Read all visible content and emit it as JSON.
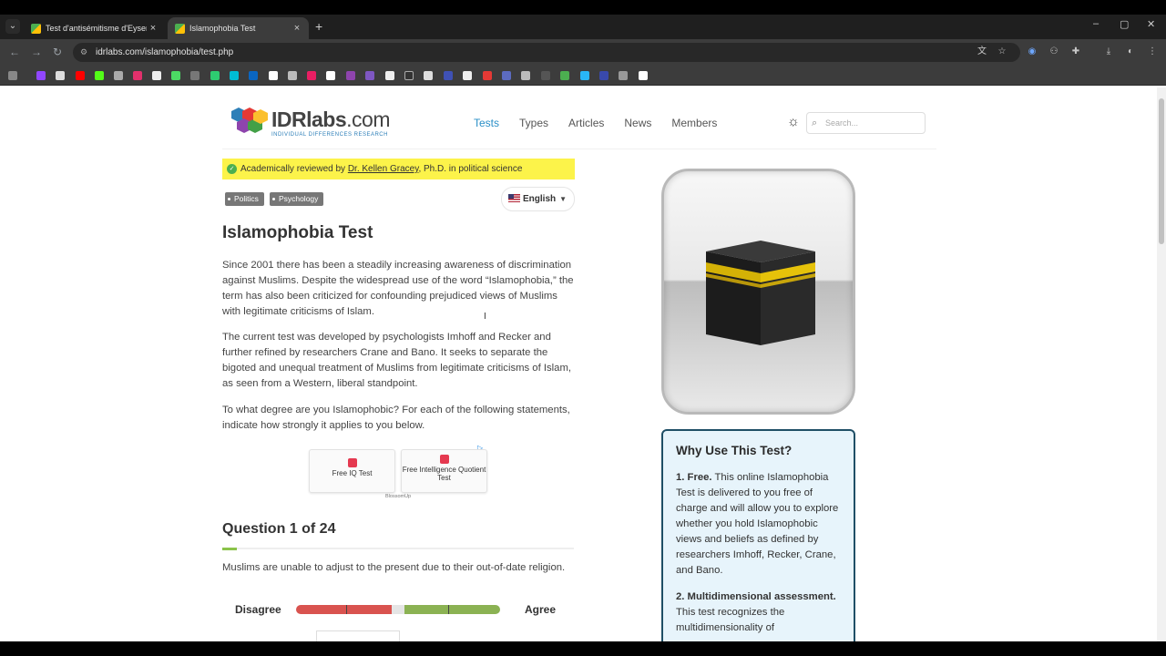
{
  "browser": {
    "tabs": [
      {
        "title": "Test d'antisémitisme d'Eysenck",
        "active": false
      },
      {
        "title": "Islamophobia Test",
        "active": true
      }
    ],
    "new_tab": "+",
    "close": "×",
    "url": "idrlabs.com/islamophobia/test.php",
    "window_controls": {
      "minimize": "–",
      "maximize": "▢",
      "close": "✕"
    }
  },
  "site": {
    "logo_main": "IDRlabs",
    "logo_suffix": ".com",
    "logo_tagline": "INDIVIDUAL DIFFERENCES RESEARCH",
    "nav": [
      "Tests",
      "Types",
      "Articles",
      "News",
      "Members"
    ],
    "active_nav": "Tests",
    "search_placeholder": "Search...",
    "theme_icon": "sun-icon"
  },
  "review": {
    "prefix": "Academically reviewed by ",
    "reviewer": "Dr. Kellen Gracey",
    "suffix": ", Ph.D. in political science"
  },
  "tags": [
    "Politics",
    "Psychology"
  ],
  "language": "English",
  "title": "Islamophobia Test",
  "paragraphs": [
    "Since 2001 there has been a steadily increasing awareness of discrimination against Muslims. Despite the widespread use of the word “Islamophobia,” the term has also been criticized for confounding prejudiced views of Muslims with legitimate criticisms of Islam.",
    "The current test was developed by psychologists Imhoff and Recker and further refined by researchers Crane and Bano. It seeks to separate the bigoted and unequal treatment of Muslims from legitimate criticisms of Islam, as seen from a Western, liberal standpoint.",
    "To what degree are you Islamophobic? For each of the following statements, indicate how strongly it applies to you below."
  ],
  "ad": {
    "card1": "Free IQ Test",
    "card2": "Free Intelligence Quotient Test",
    "brand": "BlossomUp"
  },
  "question": {
    "heading": "Question 1 of 24",
    "progress": 0.042,
    "text": "Muslims are unable to adjust to the present due to their out-of-date religion.",
    "left_label": "Disagree",
    "right_label": "Agree"
  },
  "sidebar": {
    "heading": "Why Use This Test?",
    "points": [
      {
        "title": "1. Free.",
        "text": " This online Islamophobia Test is delivered to you free of charge and will allow you to explore whether you hold Islamophobic views and beliefs as defined by researchers Imhoff, Recker, Crane, and Bano."
      },
      {
        "title": "2. Multidimensional assessment.",
        "text": " This test recognizes the multidimensionality of"
      }
    ]
  }
}
